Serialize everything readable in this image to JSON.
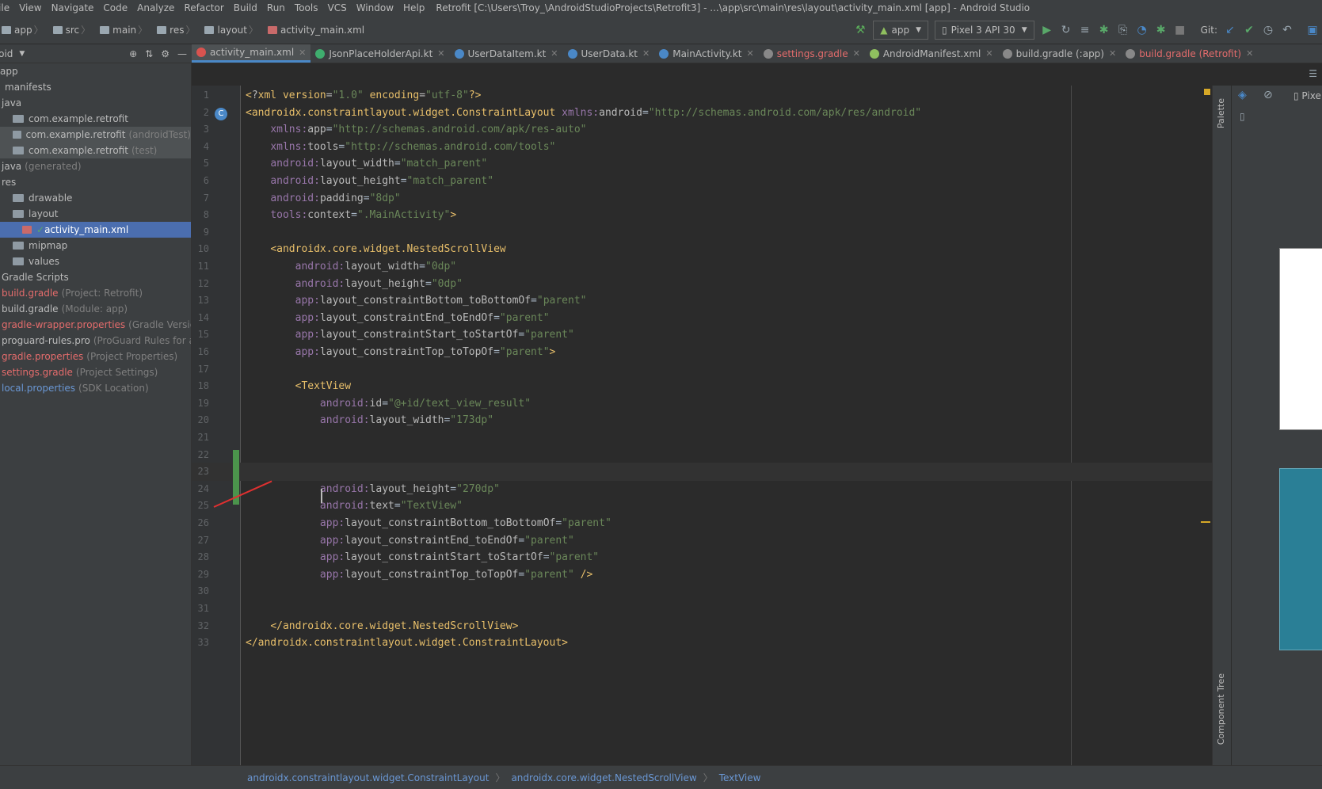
{
  "menubar": {
    "items": [
      "File",
      "View",
      "Navigate",
      "Code",
      "Analyze",
      "Refactor",
      "Build",
      "Run",
      "Tools",
      "VCS",
      "Window",
      "Help"
    ],
    "window_title": "Retrofit [C:\\Users\\Troy_\\AndroidStudioProjects\\Retrofit3] - ...\\app\\src\\main\\res\\layout\\activity_main.xml [app] - Android Studio"
  },
  "breadcrumbs": [
    "app",
    "src",
    "main",
    "res",
    "layout",
    "activity_main.xml"
  ],
  "toolbar": {
    "config": "app",
    "device": "Pixel 3 API 30",
    "git_label": "Git:"
  },
  "project_panel": {
    "title": "Android",
    "items": [
      {
        "label": "app",
        "note": "",
        "style": "normal"
      },
      {
        "label": "manifests",
        "note": "",
        "style": "normal"
      },
      {
        "label": "java",
        "note": "",
        "style": "normal"
      },
      {
        "label": "com.example.retrofit",
        "note": "",
        "style": "pkg"
      },
      {
        "label": "com.example.retrofit",
        "note": "(androidTest)",
        "style": "pkgsel"
      },
      {
        "label": "com.example.retrofit",
        "note": "(test)",
        "style": "pkgsel"
      },
      {
        "label": "java",
        "note": "(generated)",
        "style": "normal"
      },
      {
        "label": "res",
        "note": "",
        "style": "normal"
      },
      {
        "label": "drawable",
        "note": "",
        "style": "pkg"
      },
      {
        "label": "layout",
        "note": "",
        "style": "pkg"
      },
      {
        "label": "activity_main.xml",
        "note": "",
        "style": "sel"
      },
      {
        "label": "mipmap",
        "note": "",
        "style": "pkg"
      },
      {
        "label": "values",
        "note": "",
        "style": "pkg"
      },
      {
        "label": "Gradle Scripts",
        "note": "",
        "style": "normal"
      },
      {
        "label": "build.gradle",
        "note": "(Project: Retrofit)",
        "style": "red"
      },
      {
        "label": "build.gradle",
        "note": "(Module: app)",
        "style": "normal"
      },
      {
        "label": "gradle-wrapper.properties",
        "note": "(Gradle Version)",
        "style": "red"
      },
      {
        "label": "proguard-rules.pro",
        "note": "(ProGuard Rules for app)",
        "style": "normal"
      },
      {
        "label": "gradle.properties",
        "note": "(Project Properties)",
        "style": "red"
      },
      {
        "label": "settings.gradle",
        "note": "(Project Settings)",
        "style": "red"
      },
      {
        "label": "local.properties",
        "note": "(SDK Location)",
        "style": "blu"
      }
    ]
  },
  "tabs": [
    {
      "label": "activity_main.xml",
      "active": true,
      "color": "#d9534f",
      "style": "normal"
    },
    {
      "label": "JsonPlaceHolderApi.kt",
      "active": false,
      "color": "#3fae6e",
      "style": "normal"
    },
    {
      "label": "UserDataItem.kt",
      "active": false,
      "color": "#4a88c7",
      "style": "normal"
    },
    {
      "label": "UserData.kt",
      "active": false,
      "color": "#4a88c7",
      "style": "normal"
    },
    {
      "label": "MainActivity.kt",
      "active": false,
      "color": "#4a88c7",
      "style": "normal"
    },
    {
      "label": "settings.gradle",
      "active": false,
      "color": "#888888",
      "style": "red"
    },
    {
      "label": "AndroidManifest.xml",
      "active": false,
      "color": "#8fbf5f",
      "style": "normal"
    },
    {
      "label": "build.gradle (:app)",
      "active": false,
      "color": "#888888",
      "style": "normal"
    },
    {
      "label": "build.gradle (Retrofit)",
      "active": false,
      "color": "#888888",
      "style": "red"
    }
  ],
  "code_lines": [
    "<?xml version=\"1.0\" encoding=\"utf-8\"?>",
    "<androidx.constraintlayout.widget.ConstraintLayout xmlns:android=\"http://schemas.android.com/apk/res/android\"",
    "    xmlns:app=\"http://schemas.android.com/apk/res-auto\"",
    "    xmlns:tools=\"http://schemas.android.com/tools\"",
    "    android:layout_width=\"match_parent\"",
    "    android:layout_height=\"match_parent\"",
    "    android:padding=\"8dp\"",
    "    tools:context=\".MainActivity\">",
    "",
    "    <androidx.core.widget.NestedScrollView",
    "        android:layout_width=\"0dp\"",
    "        android:layout_height=\"0dp\"",
    "        app:layout_constraintBottom_toBottomOf=\"parent\"",
    "        app:layout_constraintEnd_toEndOf=\"parent\"",
    "        app:layout_constraintStart_toStartOf=\"parent\"",
    "        app:layout_constraintTop_toTopOf=\"parent\">",
    "",
    "        <TextView",
    "            android:id=\"@+id/text_view_result\"",
    "            android:layout_width=\"173dp\"",
    "",
    "",
    "",
    "            android:layout_height=\"270dp\"",
    "            android:text=\"TextView\"",
    "            app:layout_constraintBottom_toBottomOf=\"parent\"",
    "            app:layout_constraintEnd_toEndOf=\"parent\"",
    "            app:layout_constraintStart_toStartOf=\"parent\"",
    "            app:layout_constraintTop_toTopOf=\"parent\" />",
    "",
    "",
    "    </androidx.core.widget.NestedScrollView>",
    "</androidx.constraintlayout.widget.ConstraintLayout>"
  ],
  "current_line": 23,
  "right_panel": {
    "palette_label": "Palette",
    "component_tree_label": "Component Tree",
    "device_label": "Pixe"
  },
  "status_breadcrumb": [
    "androidx.constraintlayout.widget.ConstraintLayout",
    "androidx.core.widget.NestedScrollView",
    "TextView"
  ],
  "colors": {
    "accent": "#4a88c7",
    "tag": "#e8bf6a",
    "value": "#6a8759",
    "namespace": "#9876aa",
    "annotation": "#e03030"
  }
}
